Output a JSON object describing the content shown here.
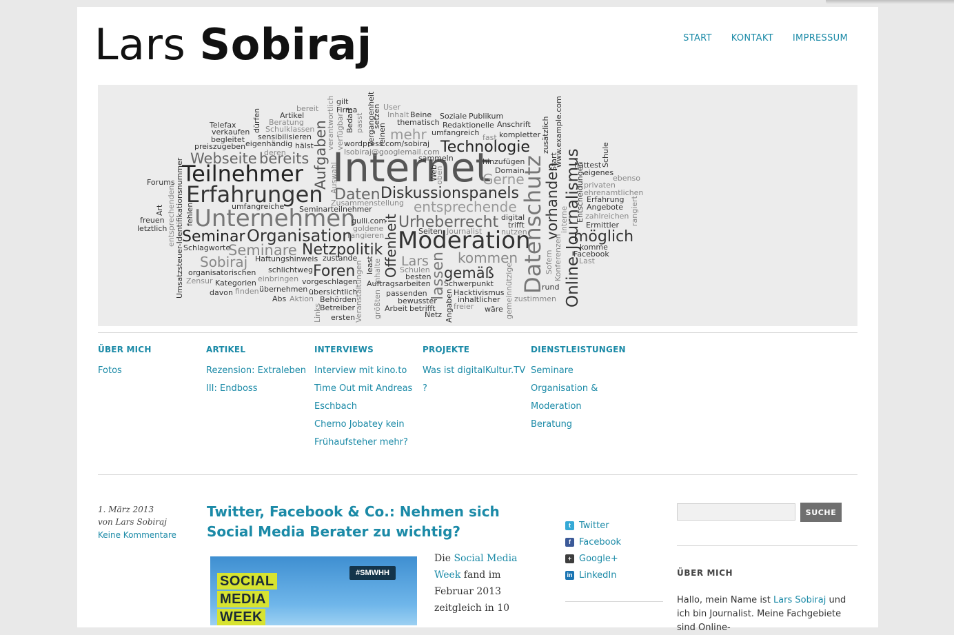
{
  "header": {
    "title_first": "Lars",
    "title_last": "Sobiraj",
    "nav": [
      "START",
      "KONTAKT",
      "IMPRESSUM"
    ]
  },
  "banner": {
    "words": [
      "Internet",
      "Moderation",
      "Teilnehmer",
      "Erfahrungen",
      "Unternehmen",
      "Organisation",
      "Datenschutz",
      "Online-Journalismus",
      "Technologie",
      "Diskussionspanels",
      "Netzpolitik",
      "Urheberrecht",
      "Seminar",
      "Seminare",
      "Webseite",
      "bereits",
      "Aufgaben",
      "Daten",
      "Gerne",
      "entsprechende",
      "möglich",
      "Foren",
      "gemäß",
      "kommen",
      "Lars",
      "Sobiraj",
      "lassen",
      "Offenheit",
      "vorhanden",
      "mehr",
      "Umsatzsteuer-Identifikationsnummer",
      "Forums",
      "Telefax",
      "verkaufen",
      "begleitet",
      "preiszugeben",
      "eigenhändig",
      "hälst",
      "Artikel",
      "Beratung",
      "Schulklassen",
      "sensibilisieren",
      "deren",
      "wordpress.com/sobiraj",
      "lsobiraj@googlemail.com",
      "sammeln",
      "hinzufügen",
      "Domain",
      "thematisch",
      "Redaktionelle",
      "Anschrift",
      "Soziale",
      "Publikum",
      "umfangreich",
      "kompletter",
      "fast",
      "Firma",
      "gilt",
      "Bedarf",
      "passt",
      "User",
      "Inhalt",
      "Beine",
      "Zusammenstellung",
      "Seminarteilnehmer",
      "umfangreiche",
      "gulli.com",
      "goldene",
      "rangieren",
      "Seiten",
      "Journalist",
      "digital",
      "trifft",
      "nutzen",
      "hattest",
      "eigenes",
      "privaten",
      "ehrenamtlichen",
      "Erfahrung",
      "Angebote",
      "zahlreichen",
      "Ermittler",
      "komme",
      "Facebook",
      "Last",
      "ebenso",
      "Schule",
      "Start",
      "zusätzlich",
      "Haftungshinweis",
      "zustande",
      "schlichtweg",
      "organisatorischen",
      "Zensur",
      "einbringen",
      "Kategorien",
      "vorgeschlagen",
      "übernehmen",
      "übersichtlich",
      "davon",
      "finden",
      "Abs",
      "Aktion",
      "Behörden",
      "Betreiber",
      "ersten",
      "Schlagworte",
      "Auftragsarbeiten",
      "Schwerpunkt",
      "Schulen",
      "besten",
      "passenden",
      "bewusster",
      "Hacktivismus",
      "inhaltlicher",
      "Arbeit",
      "betrifft",
      "wäre",
      "Netz",
      "freier",
      "zustimmen",
      "rund",
      "Angaben",
      "größten",
      "Links",
      "Veranstaltungen",
      "Inhalte",
      "least",
      "gemeinnützige",
      "Sofern",
      "Konferenzen",
      "interne",
      "Entscheidungen",
      "rangiert",
      "Auswahl",
      "oben",
      "Web",
      "Vergangenheit",
      "reinen",
      "setzen",
      "verfügbar",
      "verantwortlich",
      "bereit",
      "dürfen",
      "Art",
      "freuen",
      "letztlich",
      "entsprechenden",
      "fehlen",
      "www.example.com"
    ]
  },
  "footer_columns": [
    {
      "title": "ÜBER MICH",
      "items": [
        "Fotos"
      ]
    },
    {
      "title": "ARTIKEL",
      "items": [
        "Rezension: Extraleben III: Endboss"
      ]
    },
    {
      "title": "INTERVIEWS",
      "items": [
        "Interview mit kino.to",
        "Time Out mit Andreas Eschbach",
        "Cherno Jobatey kein Frühaufsteher mehr?"
      ]
    },
    {
      "title": "PROJEKTE",
      "items": [
        "Was ist digitalKultur.TV ?"
      ]
    },
    {
      "title": "DIENSTLEISTUNGEN",
      "items": [
        "Seminare",
        "Organisation & Moderation",
        "Beratung"
      ]
    }
  ],
  "post": {
    "date": "1. März 2013",
    "author": "von Lars Sobiraj",
    "comments": "Keine Kommentare",
    "title": "Twitter, Facebook & Co.: Nehmen sich Social Media Berater zu wichtig?",
    "image_words": [
      "SOCIAL",
      "MEDIA",
      "WEEK"
    ],
    "image_tag": "#SMWHH",
    "text_before": "Die ",
    "text_link": "Social Media Week",
    "text_after": " fand im Februar 2013 zeitgleich in 10"
  },
  "social": [
    {
      "label": "Twitter",
      "icon": "twitter-icon",
      "color": "#35a9d6",
      "glyph": "t"
    },
    {
      "label": "Facebook",
      "icon": "facebook-icon",
      "color": "#3b5998",
      "glyph": "f"
    },
    {
      "label": "Google+",
      "icon": "google-plus-icon",
      "color": "#3d3d3d",
      "glyph": "+"
    },
    {
      "label": "LinkedIn",
      "icon": "linkedin-icon",
      "color": "#1b75b3",
      "glyph": "in"
    }
  ],
  "sidebar": {
    "search_button": "SUCHE",
    "about_title": "ÜBER MICH",
    "about_before": "Hallo, mein Name ist ",
    "about_link": "Lars Sobiraj",
    "about_after": " und ich bin Journalist. Meine Fachgebiete sind Online-"
  },
  "colors": {
    "link": "#1b8aa7",
    "background": "#e9e9e9",
    "banner": "#ececec"
  }
}
